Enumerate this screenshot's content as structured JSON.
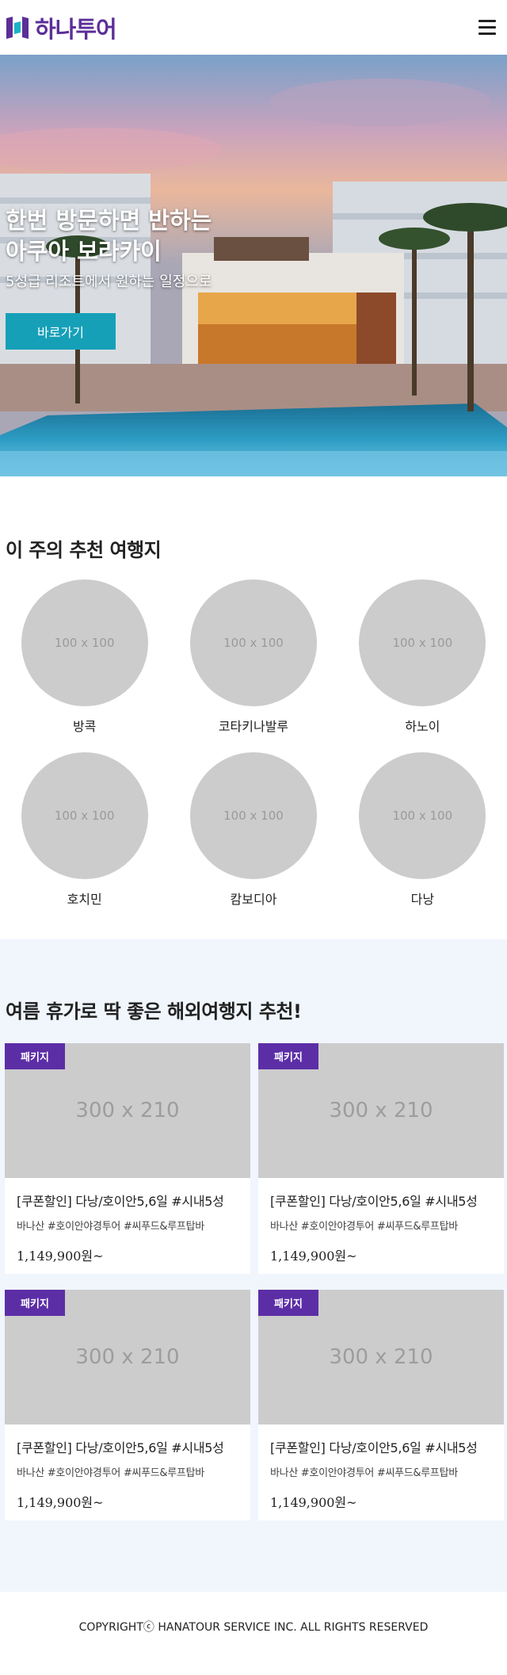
{
  "header": {
    "logo_text": "하나투어",
    "menu_icon": "hamburger-menu-icon"
  },
  "hero": {
    "title": "한번 방문하면 반하는\n아쿠아 보라카이",
    "subtitle": "5성급 리조트에서 원하는 일정으로",
    "button_label": "바로가기"
  },
  "destinations": {
    "title": "이 주의 추천 여행지",
    "items": [
      {
        "placeholder": "100 x 100",
        "name": "방콕"
      },
      {
        "placeholder": "100 x 100",
        "name": "코타키나발루"
      },
      {
        "placeholder": "100 x 100",
        "name": "하노이"
      },
      {
        "placeholder": "100 x 100",
        "name": "호치민"
      },
      {
        "placeholder": "100 x 100",
        "name": "캄보디아"
      },
      {
        "placeholder": "100 x 100",
        "name": "다낭"
      }
    ]
  },
  "packages": {
    "title": "여름 휴가로 딱 좋은 해외여행지 추천!",
    "items": [
      {
        "badge": "패키지",
        "placeholder": "300 x 210",
        "title": "[쿠폰할인] 다낭/호이안5,6일 #시내5성",
        "tags": "바나산 #호이안야경투어 #씨푸드&루프탑바",
        "price": "1,149,900원~"
      },
      {
        "badge": "패키지",
        "placeholder": "300 x 210",
        "title": "[쿠폰할인] 다낭/호이안5,6일 #시내5성",
        "tags": "바나산 #호이안야경투어 #씨푸드&루프탑바",
        "price": "1,149,900원~"
      },
      {
        "badge": "패키지",
        "placeholder": "300 x 210",
        "title": "[쿠폰할인] 다낭/호이안5,6일 #시내5성",
        "tags": "바나산 #호이안야경투어 #씨푸드&루프탑바",
        "price": "1,149,900원~"
      },
      {
        "badge": "패키지",
        "placeholder": "300 x 210",
        "title": "[쿠폰할인] 다낭/호이안5,6일 #시내5성",
        "tags": "바나산 #호이안야경투어 #씨푸드&루프탑바",
        "price": "1,149,900원~"
      }
    ]
  },
  "footer": {
    "copyright": "COPYRIGHTⓒ HANATOUR SERVICE INC. ALL RIGHTS RESERVED"
  }
}
